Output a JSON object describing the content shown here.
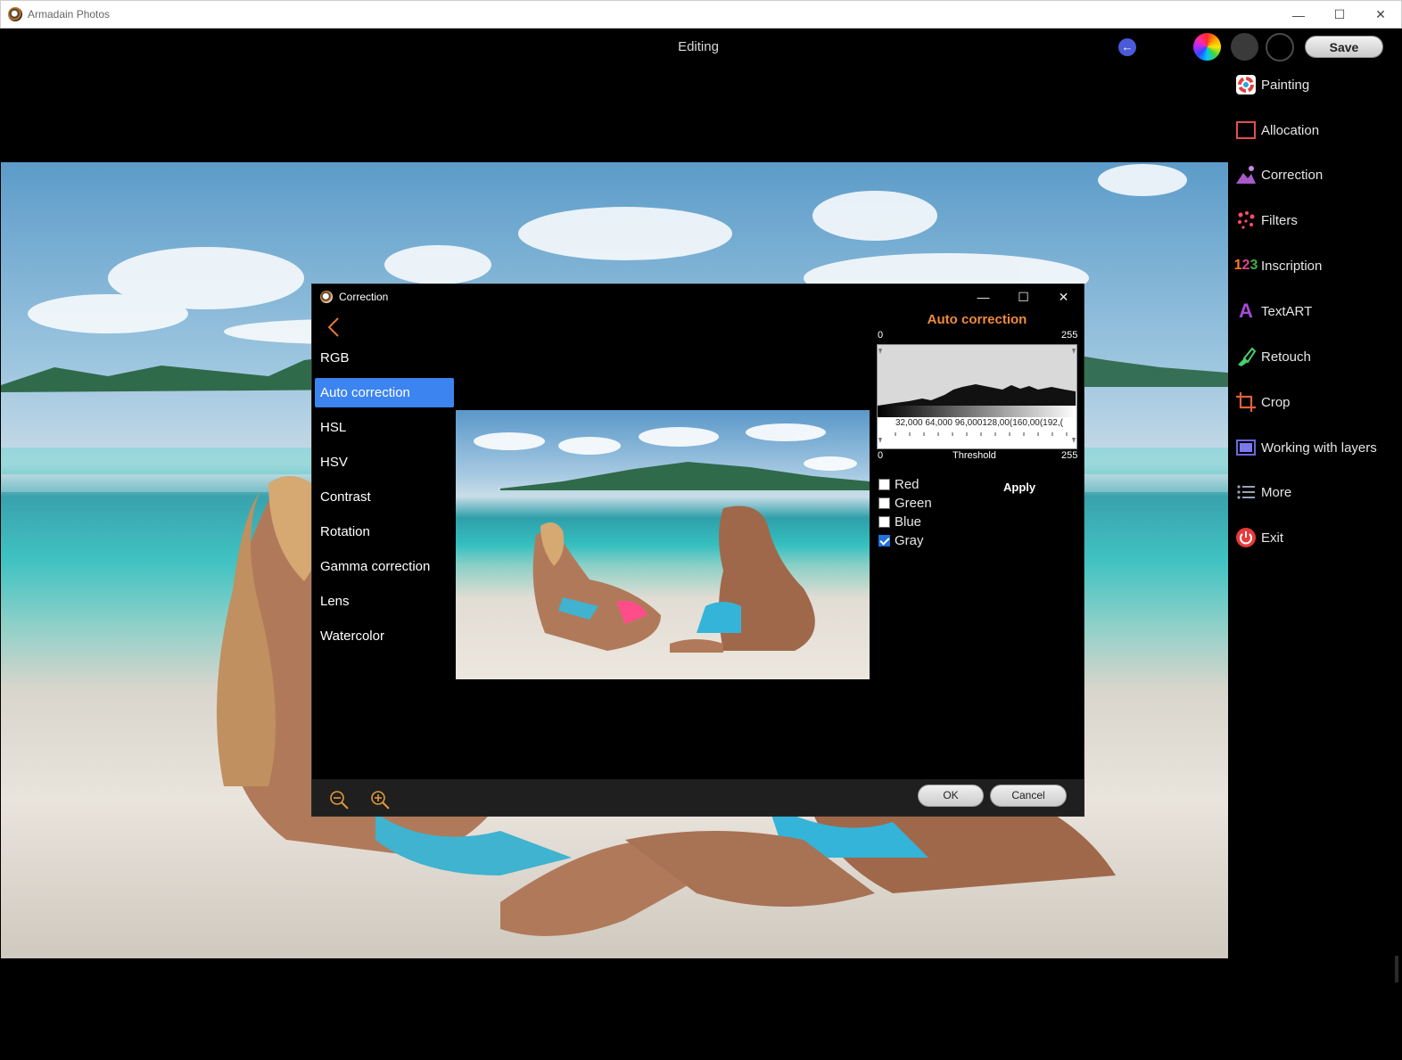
{
  "window": {
    "title": "Armadain Photos",
    "controls": [
      "—",
      "☐",
      "✕"
    ]
  },
  "header": {
    "title": "Editing",
    "save_label": "Save"
  },
  "sidebar": {
    "items": [
      {
        "label": "Painting",
        "icon": "painting-icon"
      },
      {
        "label": "Allocation",
        "icon": "allocation-icon"
      },
      {
        "label": "Correction",
        "icon": "correction-icon"
      },
      {
        "label": "Filters",
        "icon": "filters-icon"
      },
      {
        "label": "Inscription",
        "icon": "inscription-icon"
      },
      {
        "label": "TextART",
        "icon": "textart-icon"
      },
      {
        "label": "Retouch",
        "icon": "retouch-icon"
      },
      {
        "label": "Crop",
        "icon": "crop-icon"
      },
      {
        "label": "Working with layers",
        "icon": "layers-icon"
      },
      {
        "label": "More",
        "icon": "more-icon"
      },
      {
        "label": "Exit",
        "icon": "exit-icon"
      }
    ]
  },
  "dialog": {
    "title": "Correction",
    "menu": [
      {
        "label": "RGB",
        "active": false
      },
      {
        "label": "Auto correction",
        "active": true
      },
      {
        "label": "HSL",
        "active": false
      },
      {
        "label": "HSV",
        "active": false
      },
      {
        "label": "Contrast",
        "active": false
      },
      {
        "label": "Rotation",
        "active": false
      },
      {
        "label": "Gamma correction",
        "active": false
      },
      {
        "label": "Lens",
        "active": false
      },
      {
        "label": "Watercolor",
        "active": false
      }
    ],
    "panel": {
      "title": "Auto correction",
      "hist_min": "0",
      "hist_max": "255",
      "hist_ticks": "32,000 64,000 96,000128,00(160,00(192,(",
      "threshold_label": "Threshold",
      "threshold_min": "0",
      "threshold_max": "255",
      "channels": [
        {
          "label": "Red",
          "checked": false
        },
        {
          "label": "Green",
          "checked": false
        },
        {
          "label": "Blue",
          "checked": false
        },
        {
          "label": "Gray",
          "checked": true
        }
      ],
      "apply_label": "Apply"
    },
    "footer": {
      "ok_label": "OK",
      "cancel_label": "Cancel"
    }
  },
  "colors": {
    "accent": "#3c84f0",
    "panel_title": "#f08a3c",
    "back_button": "#4a5ad8"
  }
}
